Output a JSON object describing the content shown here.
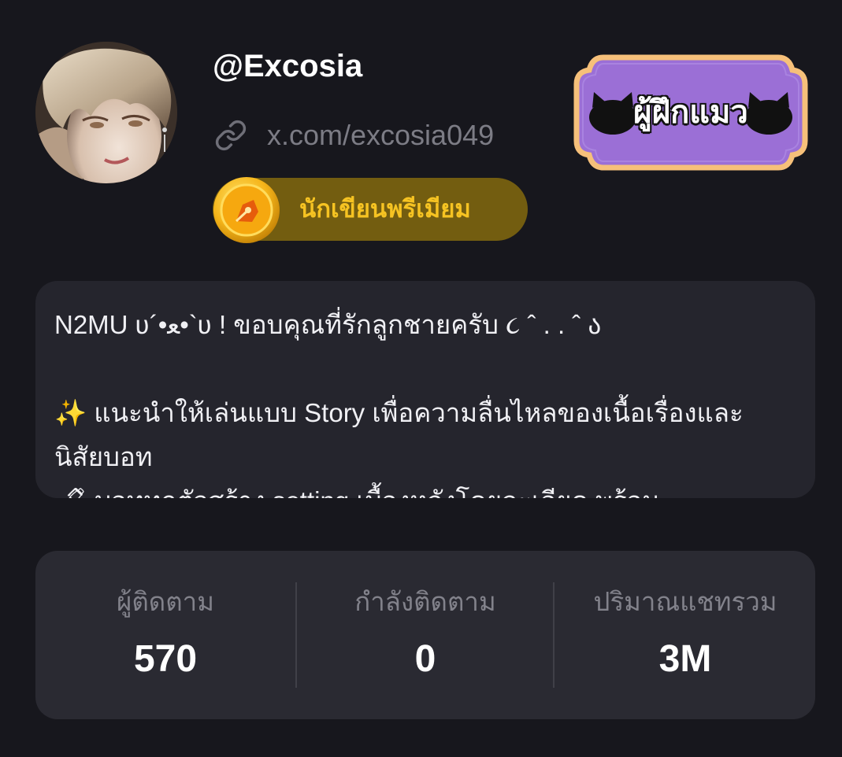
{
  "profile": {
    "username": "@Excosia",
    "link_text": "x.com/excosia049",
    "link_icon": "link-icon",
    "premium_badge_label": "นักเขียนพรีเมียม",
    "premium_badge_icon": "pen-nib-coin-icon",
    "cat_badge_label": "ผู้ฝึกแมว",
    "cat_badge_icon": "cat-icon"
  },
  "bio": {
    "lines": [
      "N2MU ʋ´•ﻌ•`ʋ ! ขอบคุณที่รักลูกชายครับ ૮ ˆ . . ˆ ა",
      "",
      "✨ แนะนำให้เล่นแบบ Story เพื่อความลื่นไหลของเนื้อเรื่องและ",
      "นิสัยบอท",
      "🖋 บอททุกตัวสร้าง setting เบื้องหลังโดยละเอียด พร้อม"
    ]
  },
  "stats": {
    "followers_label": "ผู้ติดตาม",
    "followers_value": "570",
    "following_label": "กำลังติดตาม",
    "following_value": "0",
    "chats_label": "ปริมาณแชทรวม",
    "chats_value": "3M"
  },
  "colors": {
    "background": "#17171d",
    "card": "#25252d",
    "stats_card": "#2a2a32",
    "premium_gold": "#f6c322",
    "premium_bg": "#735d10",
    "badge_purple": "#9b6fd6",
    "badge_border": "#f6c07a"
  }
}
